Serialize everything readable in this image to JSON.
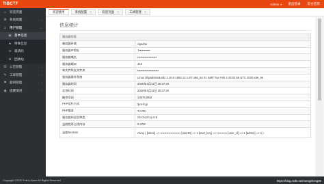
{
  "header": {
    "logo": "TIBCTF",
    "user": "Admin",
    "links": [
      "退出登录",
      "前台首页"
    ]
  },
  "sidebar": {
    "items": [
      {
        "icon": "home-icon",
        "glyph": "⌂",
        "label": "欢迎页面",
        "arrow": ""
      },
      {
        "icon": "settings-icon",
        "glyph": "⚙",
        "label": "系统配置",
        "arrow": "‹"
      },
      {
        "icon": "users-icon",
        "glyph": "☺",
        "label": "用户管理",
        "arrow": "⌄"
      }
    ],
    "subitems": [
      {
        "icon": "user-info-icon",
        "glyph": "▣",
        "label": "基本信息",
        "current": true
      },
      {
        "icon": "special-user-icon",
        "glyph": "★",
        "label": "特殊信息",
        "current": false
      },
      {
        "icon": "invite-code-icon",
        "glyph": "✉",
        "label": "邀请码",
        "current": false
      },
      {
        "icon": "recycle-bin-icon",
        "glyph": "♻",
        "label": "回收站",
        "current": false
      }
    ],
    "items2": [
      {
        "icon": "notice-icon",
        "glyph": "☰",
        "label": "公告管理",
        "arrow": "‹"
      },
      {
        "icon": "ticket-icon",
        "glyph": "✎",
        "label": "工单管理",
        "arrow": "‹"
      },
      {
        "icon": "challenge-icon",
        "glyph": "⚑",
        "label": "题目管理",
        "arrow": "‹"
      },
      {
        "icon": "status-icon",
        "glyph": "◉",
        "label": "提醒情况",
        "arrow": "‹"
      }
    ]
  },
  "tabs": [
    {
      "label": "欢迎使用",
      "active": true
    },
    {
      "label": "系统配置",
      "active": false
    },
    {
      "label": "欢迎页面",
      "active": false
    },
    {
      "label": "工具管理",
      "active": false
    }
  ],
  "main": {
    "title": "信息统计",
    "table_header": "服务器信息",
    "rows": [
      {
        "key": "服务器环境",
        "value": "Apache"
      },
      {
        "key": "服务器IP地址",
        "value": "1▪▪▪▪▪▪▪▪▪▪▪"
      },
      {
        "key": "服务器域名",
        "value": "▪▪▪▪▪▪▪▪▪▪▪▪▪▪▪▪▪▪▪"
      },
      {
        "key": "服务器端口",
        "value": "443"
      },
      {
        "key": "本文件所在文件夹",
        "value": "▪▪▪▪▪▪▪▪▪▪▪▪▪▪▪▪▪▪▪▪▪"
      },
      {
        "key": "服务器操作系统",
        "value": "Linux izbpIabima1wdz 3.10.0-1062.12.1.el7.x86_64 #1 SMP Tue Feb 4 23:02:59 UTC 2020 x86_64"
      },
      {
        "key": "服务器时间",
        "value": "2020年3月11日 20:37:20"
      },
      {
        "key": "北京时间",
        "value": "2020年3月11日 20:37:20"
      },
      {
        "key": "剩余空间",
        "value": "10576.09M"
      },
      {
        "key": "PHP运行方式",
        "value": "fpm-fcgi"
      },
      {
        "key": "PHP版本",
        "value": "7.0.33"
      },
      {
        "key": "服务器的语言种类",
        "value": "zh-CN,zh;q=0.9"
      },
      {
        "key": "当前程序占用内存",
        "value": "0.37M"
      },
      {
        "key": "当前Session",
        "value": "Array ( [token] => ▪▪▪▪▪▪▪▪▪▪▪▪▪▪▪▪▪▪▪▪ [userID] => 1 [user_key] => ▪▪▪▪▪▪▪▪▪▪ [user_cl] => 1 [admin] => 1 )"
      }
    ]
  },
  "footer": {
    "copyright": "Copyright ©2020 Tide's Home All Rights Reserved",
    "watermark": "https://blog.csdn.net/mengsheng86"
  },
  "colors": {
    "accent": "#e8470f",
    "sidebar": "#2c3035"
  }
}
